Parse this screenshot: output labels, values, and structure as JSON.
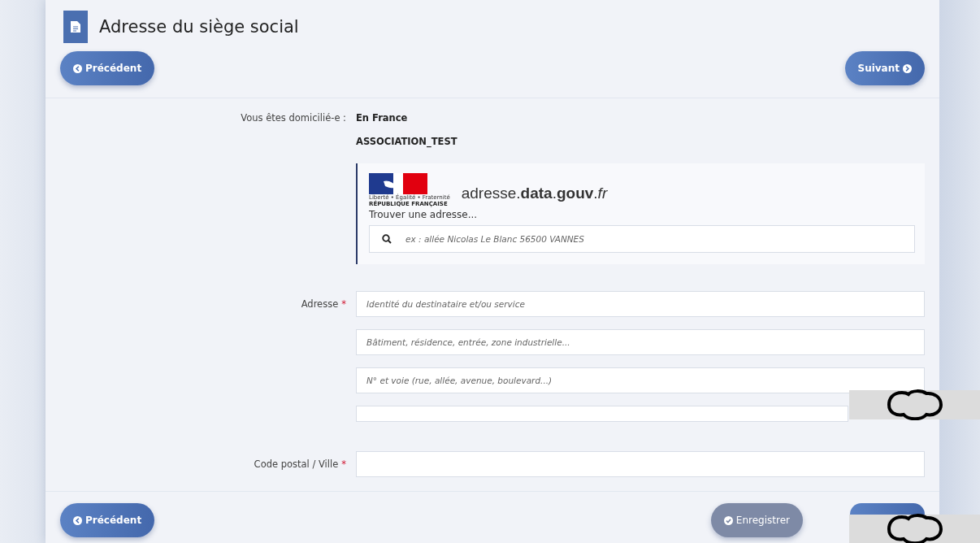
{
  "page_title": "Adresse du siège social",
  "top_nav": {
    "previous": "Précédent",
    "next": "Suivant"
  },
  "summary": {
    "label": "Vous êtes domicilié-e :",
    "value": "En France",
    "name": "ASSOCIATION_TEST"
  },
  "address_search": {
    "motto": "Liberté • Égalité • Fraternité",
    "republic": "RÉPUBLIQUE FRANÇAISE",
    "brand": "adresse.**data**.**gouv**.*fr*",
    "label": "Trouver une adresse...",
    "placeholder": "ex : allée Nicolas Le Blanc 56500 VANNES"
  },
  "address": {
    "label": "Adresse",
    "required_mark": "*",
    "fields": [
      {
        "kind": "text",
        "placeholder": "Identité du destinataire et/ou service"
      },
      {
        "kind": "text",
        "placeholder": "Bâtiment, résidence, entrée, zone industrielle..."
      },
      {
        "kind": "text",
        "placeholder": "N° et voie (rue, allée, avenue, boulevard...)"
      },
      {
        "kind": "obscured"
      }
    ]
  },
  "postal": {
    "label": "Code postal / Ville",
    "required_mark": "*"
  },
  "bottom_nav": {
    "previous": "Précédent",
    "save": "Enregistrer"
  }
}
